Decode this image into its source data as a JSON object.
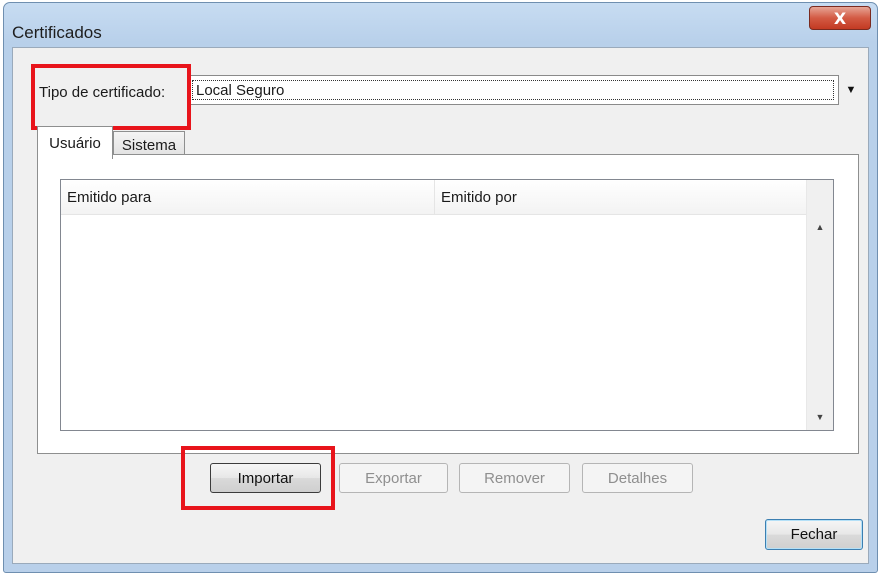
{
  "window": {
    "title": "Certificados",
    "close_label": "X"
  },
  "certificate_type": {
    "label": "Tipo de certificado:",
    "value": "Local Seguro",
    "arrow": "▼"
  },
  "tabs": [
    {
      "label": "Usuário",
      "selected": true
    },
    {
      "label": "Sistema",
      "selected": false
    }
  ],
  "list": {
    "columns": [
      "Emitido para",
      "Emitido por"
    ],
    "rows": [],
    "scroll_up": "▲",
    "scroll_down": "▼"
  },
  "buttons": {
    "importar": "Importar",
    "exportar": "Exportar",
    "remover": "Remover",
    "detalhes": "Detalhes",
    "fechar": "Fechar"
  },
  "colors": {
    "highlight": "#e8141b",
    "title_bar": "#b9d0ea",
    "close_button": "#c33a22"
  }
}
